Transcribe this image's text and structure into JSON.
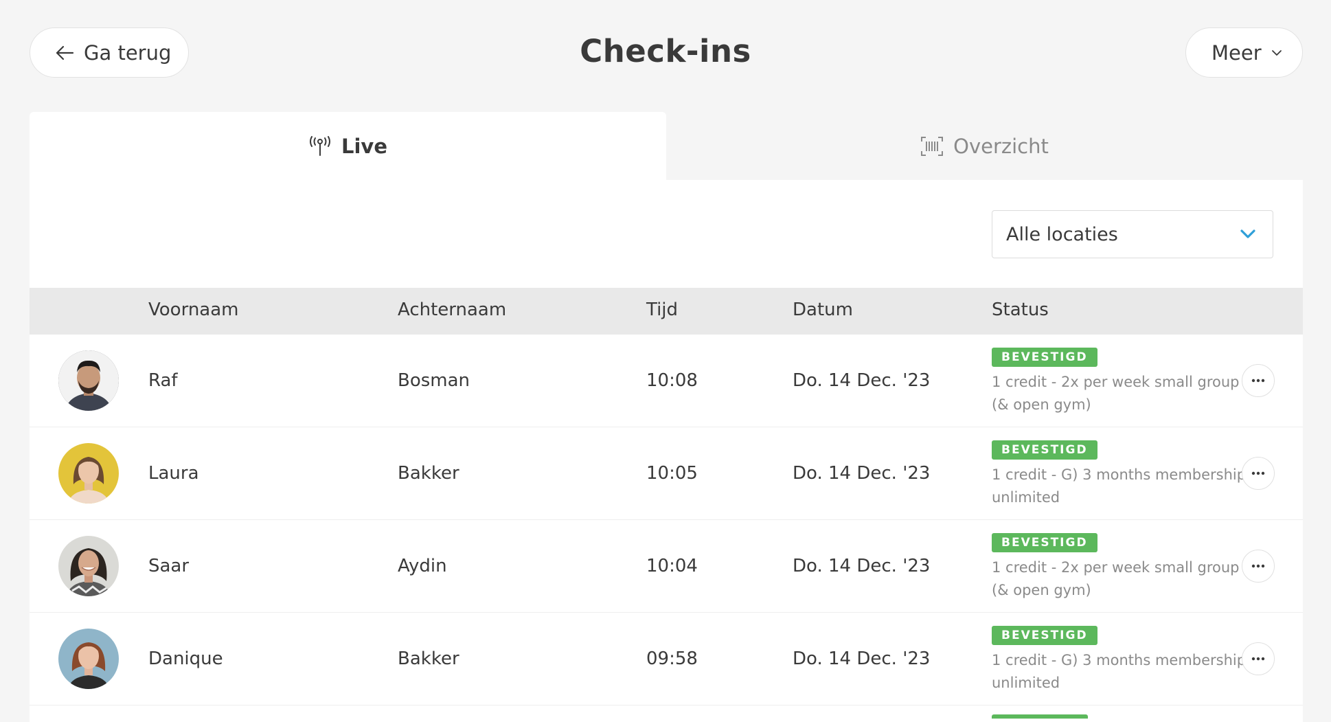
{
  "header": {
    "back_label": "Ga terug",
    "title": "Check-ins",
    "more_label": "Meer"
  },
  "tabs": [
    {
      "label": "Live",
      "icon": "broadcast-icon",
      "active": true
    },
    {
      "label": "Overzicht",
      "icon": "barcode-scan-icon",
      "active": false
    }
  ],
  "location_select": {
    "value": "Alle locaties",
    "accent_color": "#2f9fd8"
  },
  "table": {
    "columns": [
      "Voornaam",
      "Achternaam",
      "Tijd",
      "Datum",
      "Status"
    ],
    "rows": [
      {
        "first": "Raf",
        "last": "Bosman",
        "time": "10:08",
        "date": "Do. 14 Dec. '23",
        "status": "BEVESTIGD",
        "plan": "1 credit - 2x per week small group (& open gym)",
        "avatar_bg": "#3b3d44"
      },
      {
        "first": "Laura",
        "last": "Bakker",
        "time": "10:05",
        "date": "Do. 14 Dec. '23",
        "status": "BEVESTIGD",
        "plan": "1 credit - G) 3 months membership unlimited",
        "avatar_bg": "#e3c43a"
      },
      {
        "first": "Saar",
        "last": "Aydin",
        "time": "10:04",
        "date": "Do. 14 Dec. '23",
        "status": "BEVESTIGD",
        "plan": "1 credit - 2x per week small group (& open gym)",
        "avatar_bg": "#d9d9d6"
      },
      {
        "first": "Danique",
        "last": "Bakker",
        "time": "09:58",
        "date": "Do. 14 Dec. '23",
        "status": "BEVESTIGD",
        "plan": "1 credit - G) 3 months membership unlimited",
        "avatar_bg": "#8fb5c9"
      }
    ]
  },
  "colors": {
    "status_confirmed": "#5cb85c",
    "page_bg": "#f5f5f5",
    "header_row_bg": "#e9e9e9"
  }
}
